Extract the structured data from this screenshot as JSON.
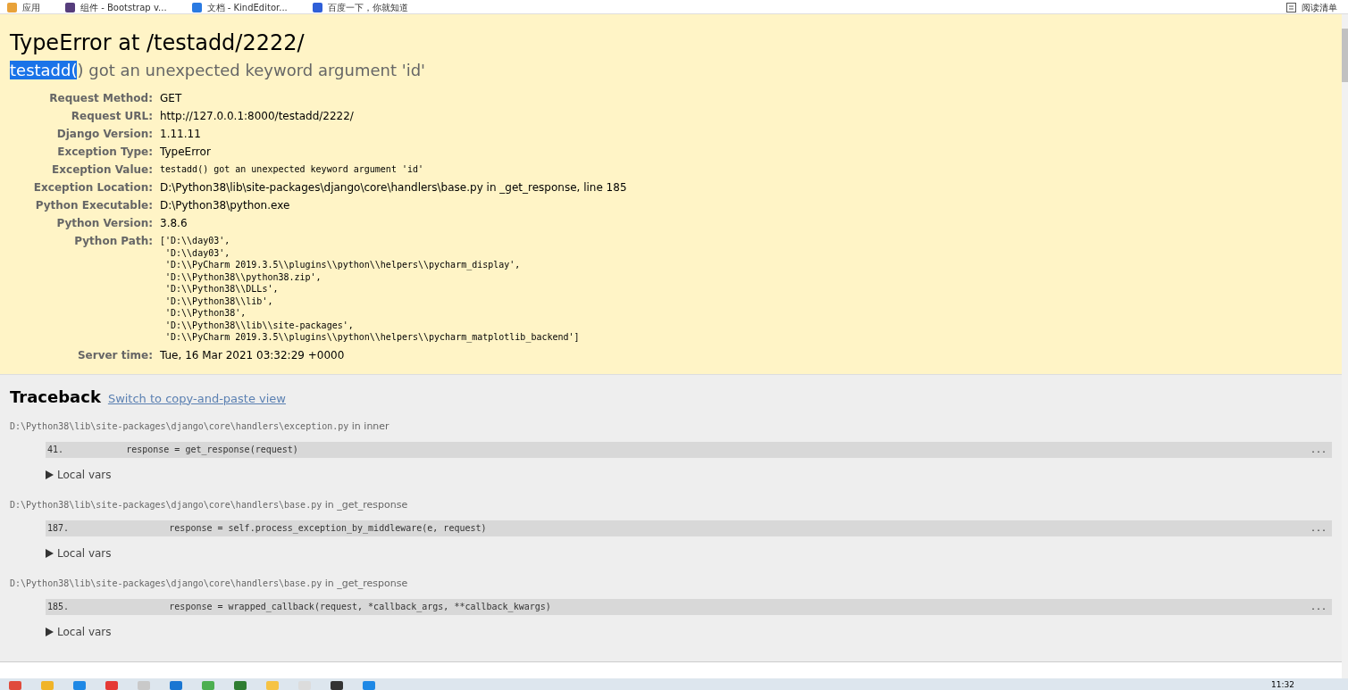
{
  "bookmarks_bar": {
    "items": [
      {
        "label": "应用",
        "kind": "apps"
      },
      {
        "label": "组件 - Bootstrap v...",
        "kind": "bootstrap"
      },
      {
        "label": "文档 - KindEditor...",
        "kind": "kindeditor"
      },
      {
        "label": "百度一下，你就知道",
        "kind": "baidu"
      }
    ],
    "reading_list": "阅读清单"
  },
  "summary": {
    "title": "TypeError at /testadd/2222/",
    "message": {
      "highlighted": "testadd(",
      "rest": ") got an unexpected keyword argument 'id'"
    },
    "meta": [
      {
        "label": "Request Method:",
        "value": "GET",
        "kind": "text"
      },
      {
        "label": "Request URL:",
        "value": "http://127.0.0.1:8000/testadd/2222/",
        "kind": "text"
      },
      {
        "label": "Django Version:",
        "value": "1.11.11",
        "kind": "text"
      },
      {
        "label": "Exception Type:",
        "value": "TypeError",
        "kind": "text"
      },
      {
        "label": "Exception Value:",
        "value": "testadd() got an unexpected keyword argument 'id'",
        "kind": "code"
      },
      {
        "label": "Exception Location:",
        "value": "D:\\Python38\\lib\\site-packages\\django\\core\\handlers\\base.py in _get_response, line 185",
        "kind": "text"
      },
      {
        "label": "Python Executable:",
        "value": "D:\\Python38\\python.exe",
        "kind": "text"
      },
      {
        "label": "Python Version:",
        "value": "3.8.6",
        "kind": "text"
      },
      {
        "label": "Python Path:",
        "value": "['D:\\\\day03',\n 'D:\\\\day03',\n 'D:\\\\PyCharm 2019.3.5\\\\plugins\\\\python\\\\helpers\\\\pycharm_display',\n 'D:\\\\Python38\\\\python38.zip',\n 'D:\\\\Python38\\\\DLLs',\n 'D:\\\\Python38\\\\lib',\n 'D:\\\\Python38',\n 'D:\\\\Python38\\\\lib\\\\site-packages',\n 'D:\\\\PyCharm 2019.3.5\\\\plugins\\\\python\\\\helpers\\\\pycharm_matplotlib_backend']",
        "kind": "code"
      },
      {
        "label": "Server time:",
        "value": "Tue, 16 Mar 2021 03:32:29 +0000",
        "kind": "text"
      }
    ]
  },
  "traceback": {
    "title": "Traceback",
    "link": "Switch to copy-and-paste view",
    "frames": [
      {
        "file": "D:\\Python38\\lib\\site-packages\\django\\core\\handlers\\exception.py",
        "in": "in",
        "function": "inner",
        "line_no": "41.",
        "code": "        response = get_response(request)",
        "more": "...",
        "local_vars": "Local vars"
      },
      {
        "file": "D:\\Python38\\lib\\site-packages\\django\\core\\handlers\\base.py",
        "in": "in",
        "function": "_get_response",
        "line_no": "187.",
        "code": "                response = self.process_exception_by_middleware(e, request)",
        "more": "...",
        "local_vars": "Local vars"
      },
      {
        "file": "D:\\Python38\\lib\\site-packages\\django\\core\\handlers\\base.py",
        "in": "in",
        "function": "_get_response",
        "line_no": "185.",
        "code": "                response = wrapped_callback(request, *callback_args, **callback_kwargs)",
        "more": "...",
        "local_vars": "Local vars"
      }
    ]
  },
  "taskbar": {
    "clock": "11:32"
  }
}
